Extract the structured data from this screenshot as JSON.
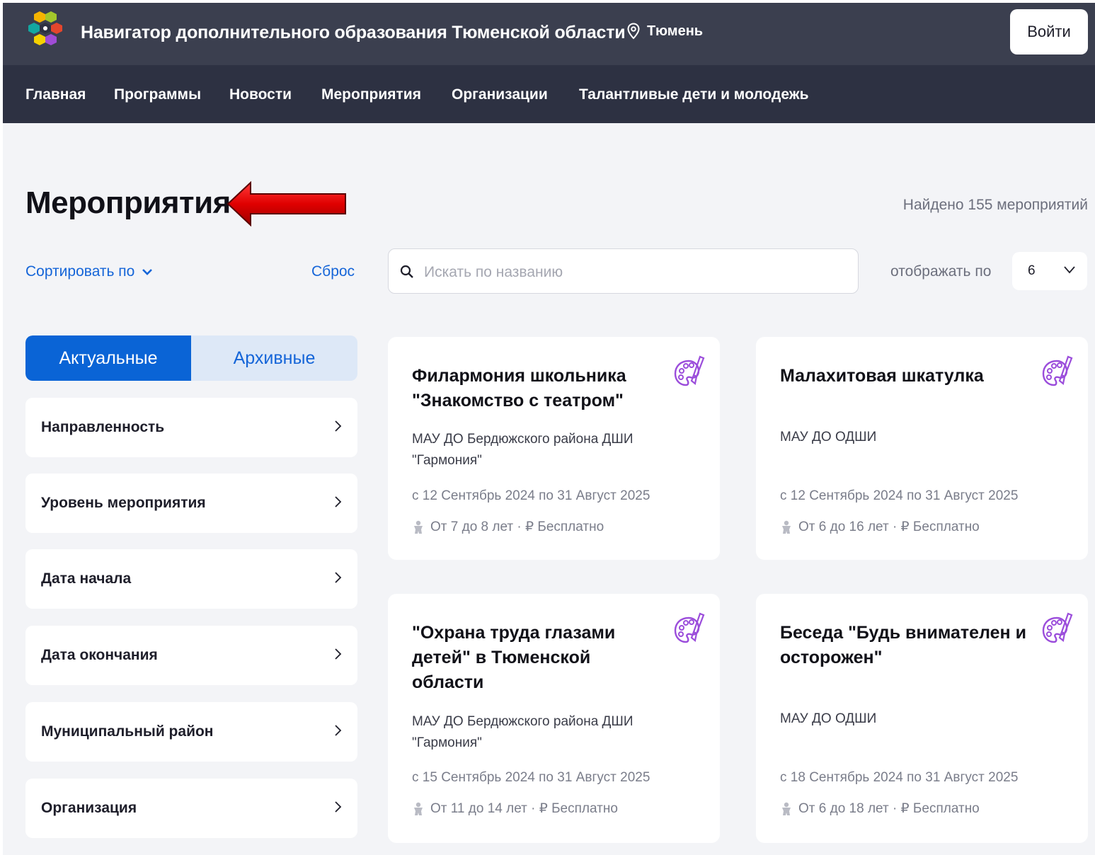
{
  "header": {
    "site_title": "Навигатор дополнительного образования Тюменской области",
    "location": "Тюмень",
    "login_label": "Войти"
  },
  "nav": {
    "items": [
      {
        "label": "Главная"
      },
      {
        "label": "Программы"
      },
      {
        "label": "Новости"
      },
      {
        "label": "Мероприятия"
      },
      {
        "label": "Организации"
      },
      {
        "label": "Талантливые дети и молодежь"
      }
    ]
  },
  "page": {
    "title": "Мероприятия",
    "found_text": "Найдено 155 мероприятий"
  },
  "controls": {
    "sort_label": "Сортировать по",
    "reset_label": "Сброс",
    "search_placeholder": "Искать по названию",
    "search_value": "",
    "per_page_label": "отображать по",
    "per_page_value": "6"
  },
  "tabs": {
    "active": "Актуальные",
    "archive": "Архивные"
  },
  "filters": [
    {
      "label": "Направленность"
    },
    {
      "label": "Уровень мероприятия"
    },
    {
      "label": "Дата начала"
    },
    {
      "label": "Дата окончания"
    },
    {
      "label": "Муниципальный район"
    },
    {
      "label": "Организация"
    }
  ],
  "cards": [
    {
      "title": "Филармония школьника \"Знакомство с театром\"",
      "org": "МАУ ДО Бердюжского района ДШИ \"Гармония\"",
      "dates": "с 12 Сентябрь 2024 по 31 Август 2025",
      "meta": "От 7 до 8 лет · ₽ Бесплатно",
      "icon": "palette-icon"
    },
    {
      "title": "Малахитовая шкатулка",
      "org": "МАУ ДО ОДШИ",
      "dates": "с 12 Сентябрь 2024 по 31 Август 2025",
      "meta": "От 6 до 16 лет · ₽ Бесплатно",
      "icon": "palette-icon"
    },
    {
      "title": "\"Охрана труда глазами детей\" в Тюменской области",
      "org": "МАУ ДО Бердюжского района ДШИ \"Гармония\"",
      "dates": "с 15 Сентябрь 2024 по 31 Август 2025",
      "meta": "От 11 до 14 лет · ₽ Бесплатно",
      "icon": "palette-icon"
    },
    {
      "title": "Беседа \"Будь внимателен и осторожен\"",
      "org": "МАУ ДО ОДШИ",
      "dates": "с 18 Сентябрь 2024 по 31 Август 2025",
      "meta": "От 6 до 18 лет · ₽ Бесплатно",
      "icon": "palette-icon"
    }
  ],
  "colors": {
    "header_bg": "#3b3f4f",
    "nav_bg": "#2d3142",
    "accent": "#0a64d6",
    "page_bg": "#f3f4f7",
    "arrow": "#e00000"
  }
}
